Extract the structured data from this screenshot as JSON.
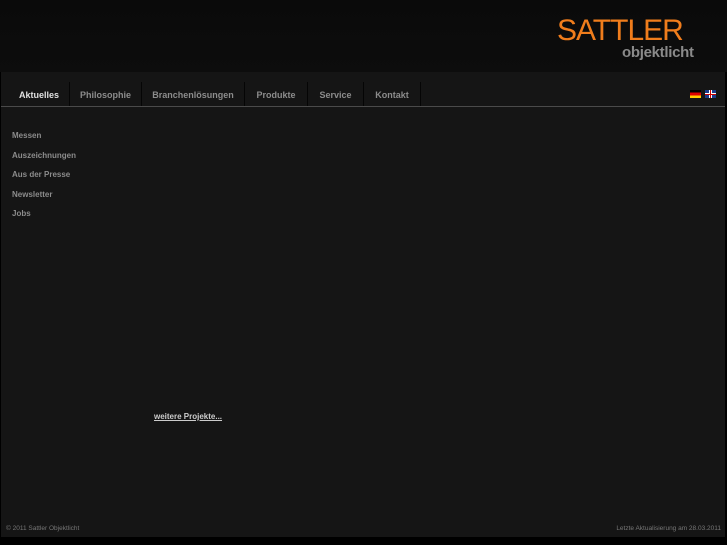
{
  "logo": {
    "line1": "SATTLER",
    "line2": "objektlicht"
  },
  "nav": [
    "Aktuelles",
    "Philosophie",
    "Branchenlösungen",
    "Produkte",
    "Service",
    "Kontakt"
  ],
  "languages": [
    "de",
    "en"
  ],
  "sidebar": [
    "Messen",
    "Auszeichnungen",
    "Aus der Presse",
    "Newsletter",
    "Jobs"
  ],
  "more_link": "weitere Projekte...",
  "footer": {
    "copyright": "© 2011 Sattler Objektlicht",
    "updated": "Letzte Aktualisierung am 28.03.2011"
  },
  "colors": {
    "accent": "#f07d1c"
  }
}
